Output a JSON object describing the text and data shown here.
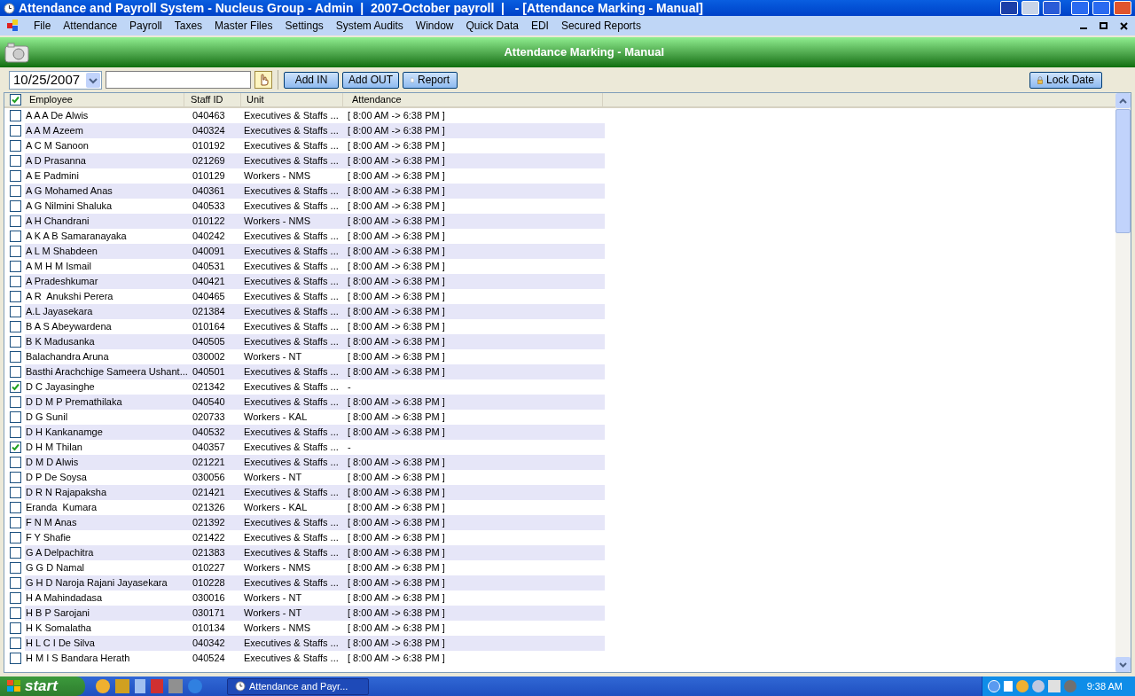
{
  "window": {
    "title": "Attendance and Payroll System - Nucleus Group - Admin  |  2007-October payroll  |   - [Attendance Marking - Manual]"
  },
  "menu": [
    "File",
    "Attendance",
    "Payroll",
    "Taxes",
    "Master Files",
    "Settings",
    "System Audits",
    "Window",
    "Quick Data",
    "EDI",
    "Secured Reports"
  ],
  "form_title": "Attendance Marking - Manual",
  "toolbar": {
    "date": "10/25/2007",
    "buttons": [
      "Add IN",
      "Add OUT",
      "Report"
    ],
    "lock_button": "Lock Date"
  },
  "table": {
    "select_all_checked": true,
    "columns": [
      "Employee",
      "Staff ID",
      "Unit",
      "Attendance"
    ],
    "rows": [
      {
        "name": "A A A De Alwis",
        "staff_id": "040463",
        "unit": "Executives & Staffs ...",
        "attendance": "[ 8:00 AM -> 6:38 PM ]",
        "checked": false
      },
      {
        "name": "A A M Azeem",
        "staff_id": "040324",
        "unit": "Executives & Staffs ...",
        "attendance": "[ 8:00 AM -> 6:38 PM ]",
        "checked": false
      },
      {
        "name": "A C M Sanoon",
        "staff_id": "010192",
        "unit": "Executives & Staffs ...",
        "attendance": "[ 8:00 AM -> 6:38 PM ]",
        "checked": false
      },
      {
        "name": "A D Prasanna",
        "staff_id": "021269",
        "unit": "Executives & Staffs ...",
        "attendance": "[ 8:00 AM -> 6:38 PM ]",
        "checked": false
      },
      {
        "name": "A E Padmini",
        "staff_id": "010129",
        "unit": "Workers - NMS",
        "attendance": "[ 8:00 AM -> 6:38 PM ]",
        "checked": false
      },
      {
        "name": "A G Mohamed Anas",
        "staff_id": "040361",
        "unit": "Executives & Staffs ...",
        "attendance": "[ 8:00 AM -> 6:38 PM ]",
        "checked": false
      },
      {
        "name": "A G Nilmini Shaluka",
        "staff_id": "040533",
        "unit": "Executives & Staffs ...",
        "attendance": "[ 8:00 AM -> 6:38 PM ]",
        "checked": false
      },
      {
        "name": "A H Chandrani",
        "staff_id": "010122",
        "unit": "Workers - NMS",
        "attendance": "[ 8:00 AM -> 6:38 PM ]",
        "checked": false
      },
      {
        "name": "A K A B Samaranayaka",
        "staff_id": "040242",
        "unit": "Executives & Staffs ...",
        "attendance": "[ 8:00 AM -> 6:38 PM ]",
        "checked": false
      },
      {
        "name": "A L M Shabdeen",
        "staff_id": "040091",
        "unit": "Executives & Staffs ...",
        "attendance": "[ 8:00 AM -> 6:38 PM ]",
        "checked": false
      },
      {
        "name": "A M H M Ismail",
        "staff_id": "040531",
        "unit": "Executives & Staffs ...",
        "attendance": "[ 8:00 AM -> 6:38 PM ]",
        "checked": false
      },
      {
        "name": "A Pradeshkumar",
        "staff_id": "040421",
        "unit": "Executives & Staffs ...",
        "attendance": "[ 8:00 AM -> 6:38 PM ]",
        "checked": false
      },
      {
        "name": "A R  Anukshi Perera",
        "staff_id": "040465",
        "unit": "Executives & Staffs ...",
        "attendance": "[ 8:00 AM -> 6:38 PM ]",
        "checked": false
      },
      {
        "name": "A.L Jayasekara",
        "staff_id": "021384",
        "unit": "Executives & Staffs ...",
        "attendance": "[ 8:00 AM -> 6:38 PM ]",
        "checked": false
      },
      {
        "name": "B A S Abeywardena",
        "staff_id": "010164",
        "unit": "Executives & Staffs ...",
        "attendance": "[ 8:00 AM -> 6:38 PM ]",
        "checked": false
      },
      {
        "name": "B K Madusanka",
        "staff_id": "040505",
        "unit": "Executives & Staffs ...",
        "attendance": "[ 8:00 AM -> 6:38 PM ]",
        "checked": false
      },
      {
        "name": "Balachandra Aruna",
        "staff_id": "030002",
        "unit": "Workers - NT",
        "attendance": "[ 8:00 AM -> 6:38 PM ]",
        "checked": false
      },
      {
        "name": "Basthi Arachchige Sameera Ushant...",
        "staff_id": "040501",
        "unit": "Executives & Staffs ...",
        "attendance": "[ 8:00 AM -> 6:38 PM ]",
        "checked": false
      },
      {
        "name": "D C Jayasinghe",
        "staff_id": "021342",
        "unit": "Executives & Staffs ...",
        "attendance": "-",
        "checked": true
      },
      {
        "name": "D D M P Premathilaka",
        "staff_id": "040540",
        "unit": "Executives & Staffs ...",
        "attendance": "[ 8:00 AM -> 6:38 PM ]",
        "checked": false
      },
      {
        "name": "D G Sunil",
        "staff_id": "020733",
        "unit": "Workers - KAL",
        "attendance": "[ 8:00 AM -> 6:38 PM ]",
        "checked": false
      },
      {
        "name": "D H Kankanamge",
        "staff_id": "040532",
        "unit": "Executives & Staffs ...",
        "attendance": "[ 8:00 AM -> 6:38 PM ]",
        "checked": false
      },
      {
        "name": "D H M Thilan",
        "staff_id": "040357",
        "unit": "Executives & Staffs ...",
        "attendance": "-",
        "checked": true
      },
      {
        "name": "D M D Alwis",
        "staff_id": "021221",
        "unit": "Executives & Staffs ...",
        "attendance": "[ 8:00 AM -> 6:38 PM ]",
        "checked": false
      },
      {
        "name": "D P De Soysa",
        "staff_id": "030056",
        "unit": "Workers - NT",
        "attendance": "[ 8:00 AM -> 6:38 PM ]",
        "checked": false
      },
      {
        "name": "D R N Rajapaksha",
        "staff_id": "021421",
        "unit": "Executives & Staffs ...",
        "attendance": "[ 8:00 AM -> 6:38 PM ]",
        "checked": false
      },
      {
        "name": "Eranda  Kumara",
        "staff_id": "021326",
        "unit": "Workers - KAL",
        "attendance": "[ 8:00 AM -> 6:38 PM ]",
        "checked": false
      },
      {
        "name": "F N M Anas",
        "staff_id": "021392",
        "unit": "Executives & Staffs ...",
        "attendance": "[ 8:00 AM -> 6:38 PM ]",
        "checked": false
      },
      {
        "name": "F Y Shafie",
        "staff_id": "021422",
        "unit": "Executives & Staffs ...",
        "attendance": "[ 8:00 AM -> 6:38 PM ]",
        "checked": false
      },
      {
        "name": "G A Delpachitra",
        "staff_id": "021383",
        "unit": "Executives & Staffs ...",
        "attendance": "[ 8:00 AM -> 6:38 PM ]",
        "checked": false
      },
      {
        "name": "G G D Namal",
        "staff_id": "010227",
        "unit": "Workers - NMS",
        "attendance": "[ 8:00 AM -> 6:38 PM ]",
        "checked": false
      },
      {
        "name": "G H D Naroja Rajani Jayasekara",
        "staff_id": "010228",
        "unit": "Executives & Staffs ...",
        "attendance": "[ 8:00 AM -> 6:38 PM ]",
        "checked": false
      },
      {
        "name": "H A Mahindadasa",
        "staff_id": "030016",
        "unit": "Workers - NT",
        "attendance": "[ 8:00 AM -> 6:38 PM ]",
        "checked": false
      },
      {
        "name": "H B P Sarojani",
        "staff_id": "030171",
        "unit": "Workers - NT",
        "attendance": "[ 8:00 AM -> 6:38 PM ]",
        "checked": false
      },
      {
        "name": "H K Somalatha",
        "staff_id": "010134",
        "unit": "Workers - NMS",
        "attendance": "[ 8:00 AM -> 6:38 PM ]",
        "checked": false
      },
      {
        "name": "H L C I De Silva",
        "staff_id": "040342",
        "unit": "Executives & Staffs ...",
        "attendance": "[ 8:00 AM -> 6:38 PM ]",
        "checked": false
      },
      {
        "name": "H M I S Bandara Herath",
        "staff_id": "040524",
        "unit": "Executives & Staffs ...",
        "attendance": "[ 8:00 AM -> 6:38 PM ]",
        "checked": false
      }
    ]
  },
  "taskbar": {
    "start": "start",
    "task": "Attendance and Payr...",
    "clock": "9:38 AM"
  }
}
